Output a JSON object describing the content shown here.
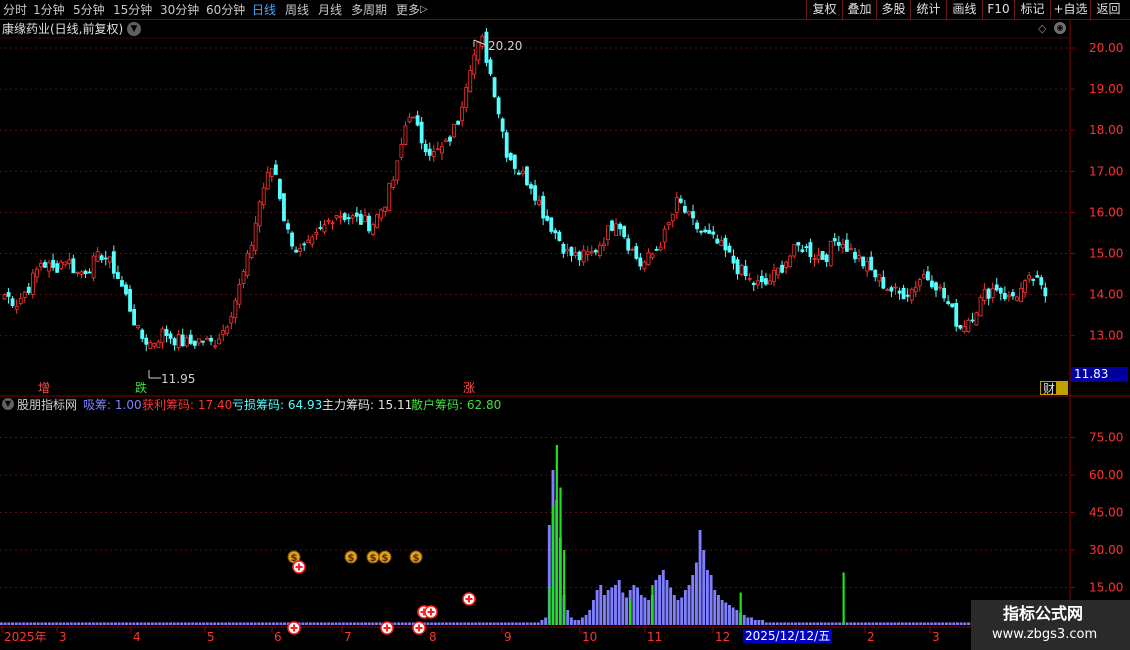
{
  "toolbar": {
    "periods": [
      "分时",
      "1分钟",
      "5分钟",
      "15分钟",
      "30分钟",
      "60分钟",
      "日线",
      "周线",
      "月线",
      "多周期",
      "更多"
    ],
    "active_period": "日线",
    "more_arrow": "▷",
    "right_buttons": [
      "复权",
      "叠加",
      "多股",
      "统计",
      "画线",
      "F10",
      "标记",
      "+自选",
      "返回"
    ]
  },
  "main_chart": {
    "title": "康缘药业(日线,前复权)",
    "high_marker": "20.20",
    "low_marker": "11.95",
    "current_price": "11.83",
    "y_ticks": [
      "20.00",
      "19.00",
      "18.00",
      "17.00",
      "16.00",
      "15.00",
      "14.00",
      "13.00"
    ],
    "signals": [
      {
        "text": "增",
        "color": "#ff5050"
      },
      {
        "text": "跌",
        "color": "#40e040"
      },
      {
        "text": "涨",
        "color": "#ff5050"
      }
    ],
    "finance_badge": "财",
    "colors": {
      "up": "#ff3232",
      "down": "#54ffff",
      "grid": "#5a1010",
      "axis": "#8b0000"
    }
  },
  "indicator": {
    "name": "股朋指标网",
    "fields": [
      {
        "label": "吸筹:",
        "value": "1.00",
        "color": "#8080ff"
      },
      {
        "label": "获利筹码:",
        "value": "17.40",
        "color": "#ff3232"
      },
      {
        "label": "亏损筹码:",
        "value": "64.93",
        "color": "#54ffff"
      },
      {
        "label": "主力筹码:",
        "value": "15.11",
        "color": "#e0e0e0"
      },
      {
        "label": "散户筹码:",
        "value": "62.80",
        "color": "#40e040"
      }
    ],
    "y_ticks": [
      "75.00",
      "60.00",
      "45.00",
      "30.00",
      "15.00"
    ],
    "colors": {
      "bars": "#8080ff",
      "green": "#20e020"
    }
  },
  "x_axis": {
    "labels": [
      "2025年",
      "3",
      "4",
      "5",
      "6",
      "7",
      "8",
      "9",
      "10",
      "11",
      "12",
      "2",
      "3"
    ],
    "highlight_date": "2025/12/12/五"
  },
  "chart_data": {
    "type": "candlestick",
    "title": "康缘药业(日线,前复权)",
    "ylim": [
      11.83,
      20.6
    ],
    "y_ticks": [
      13,
      14,
      15,
      16,
      17,
      18,
      19,
      20
    ],
    "high": 20.2,
    "low": 11.95,
    "last": 11.83,
    "close_path": [
      14.0,
      13.8,
      14.2,
      14.8,
      14.6,
      14.9,
      14.5,
      14.7,
      15.0,
      14.6,
      13.9,
      13.0,
      12.8,
      13.1,
      12.9,
      12.8,
      12.9,
      12.8,
      13.2,
      14.0,
      15.0,
      16.5,
      17.2,
      15.6,
      15.0,
      15.2,
      15.6,
      16.0,
      15.9,
      15.8,
      15.7,
      16.2,
      17.0,
      18.5,
      17.8,
      17.4,
      17.6,
      18.2,
      19.6,
      20.2,
      19.0,
      17.5,
      17.0,
      16.7,
      16.0,
      15.5,
      15.0,
      14.9,
      15.0,
      15.4,
      15.9,
      15.2,
      14.7,
      15.0,
      15.5,
      16.3,
      15.8,
      15.5,
      15.3,
      15.0,
      14.6,
      14.3,
      14.2,
      14.5,
      14.9,
      15.2,
      15.0,
      14.9,
      15.4,
      15.1,
      14.8,
      14.5,
      14.2,
      14.0,
      14.1,
      14.5,
      14.3,
      13.8,
      13.2,
      13.5,
      14.0,
      14.2,
      13.9,
      14.1,
      14.4,
      14.0
    ],
    "indicator": {
      "name": "股朋指标网",
      "ylim": [
        0,
        85
      ],
      "y_ticks": [
        15,
        30,
        45,
        60,
        75
      ],
      "series": [
        {
          "name": "吸筹",
          "last": 1.0
        },
        {
          "name": "获利筹码",
          "last": 17.4
        },
        {
          "name": "亏损筹码",
          "last": 64.93
        },
        {
          "name": "主力筹码",
          "last": 15.11
        },
        {
          "name": "散户筹码",
          "last": 62.8
        }
      ],
      "bar_profile": [
        1,
        1,
        1,
        1,
        1,
        1,
        1,
        1,
        1,
        1,
        1,
        1,
        1,
        1,
        1,
        1,
        1,
        1,
        1,
        1,
        1,
        1,
        1,
        1,
        1,
        1,
        1,
        1,
        1,
        1,
        1,
        1,
        1,
        1,
        1,
        1,
        1,
        1,
        1,
        1,
        1,
        1,
        1,
        1,
        1,
        1,
        1,
        1,
        1,
        1,
        1,
        1,
        1,
        1,
        1,
        1,
        1,
        1,
        1,
        1,
        1,
        1,
        1,
        1,
        1,
        1,
        1,
        1,
        1,
        1,
        1,
        1,
        1,
        1,
        1,
        1,
        1,
        1,
        1,
        1,
        1,
        1,
        1,
        1,
        1,
        1,
        1,
        1,
        1,
        1,
        1,
        1,
        1,
        1,
        1,
        1,
        1,
        1,
        1,
        1,
        1,
        1,
        1,
        1,
        1,
        1,
        1,
        1,
        1,
        1,
        1,
        1,
        1,
        1,
        1,
        1,
        1,
        1,
        1,
        1,
        1,
        1,
        1,
        1,
        1,
        1,
        1,
        1,
        1,
        1,
        1,
        1,
        1,
        1,
        1,
        1,
        1,
        1,
        1,
        1,
        1,
        1,
        1,
        1,
        1,
        1,
        1,
        2,
        3,
        40,
        62,
        50,
        35,
        12,
        6,
        3,
        2,
        2,
        3,
        4,
        6,
        10,
        14,
        16,
        12,
        14,
        15,
        16,
        18,
        13,
        11,
        14,
        16,
        15,
        12,
        11,
        10,
        12,
        18,
        20,
        22,
        18,
        15,
        12,
        10,
        11,
        14,
        16,
        20,
        25,
        38,
        30,
        22,
        20,
        14,
        12,
        10,
        9,
        8,
        7,
        6,
        5,
        4,
        3,
        3,
        2,
        2,
        2,
        1,
        1,
        1,
        1,
        1,
        1,
        1,
        1,
        1,
        1,
        1,
        1,
        1,
        1,
        1,
        1,
        1,
        1,
        1,
        1,
        1,
        1,
        1,
        1,
        1,
        1,
        1,
        1,
        1,
        1,
        1,
        1,
        1,
        1,
        1,
        1,
        1,
        1,
        1,
        1,
        1,
        1,
        1,
        1,
        1,
        1,
        1,
        1,
        1,
        1,
        1,
        1,
        1,
        1,
        1,
        1,
        1,
        1,
        1,
        1,
        1,
        1,
        1,
        1,
        1,
        1,
        1,
        1,
        1,
        1,
        1,
        1,
        1,
        1,
        1,
        1,
        1,
        1,
        1,
        1,
        1,
        1,
        1
      ],
      "green_bars": [
        [
          149,
          15
        ],
        [
          150,
          48
        ],
        [
          151,
          72
        ],
        [
          152,
          55
        ],
        [
          153,
          30
        ],
        [
          171,
          10
        ],
        [
          177,
          16
        ],
        [
          201,
          13
        ],
        [
          229,
          21
        ]
      ]
    }
  },
  "watermark": {
    "title": "指标公式网",
    "url": "www.zbgs3.com"
  }
}
